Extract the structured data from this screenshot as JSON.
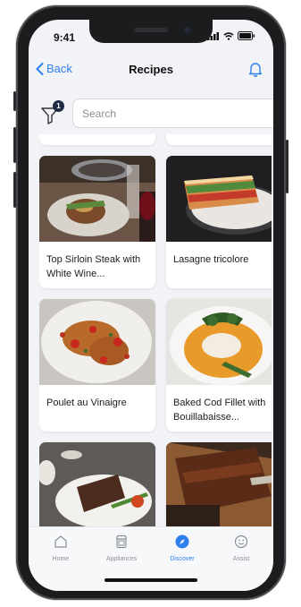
{
  "status": {
    "time": "9:41"
  },
  "nav": {
    "back_label": "Back",
    "title": "Recipes"
  },
  "filter": {
    "badge_count": "1"
  },
  "search": {
    "placeholder": "Search"
  },
  "recipes": [
    {
      "label": "Top Sirloin Steak with White Wine..."
    },
    {
      "label": "Lasagne tricolore"
    },
    {
      "label": "Poulet au Vinaigre"
    },
    {
      "label": "Baked Cod Fillet with Bouillabaisse..."
    },
    {
      "label": ""
    },
    {
      "label": ""
    }
  ],
  "tabbar": {
    "items": [
      {
        "label": "Home",
        "icon": "home-icon"
      },
      {
        "label": "Appliances",
        "icon": "appliance-icon"
      },
      {
        "label": "Discover",
        "icon": "compass-icon"
      },
      {
        "label": "Assist",
        "icon": "smiley-icon"
      }
    ],
    "active_index": 2
  },
  "colors": {
    "accent": "#2f80ed",
    "badge": "#1e2a44",
    "background": "#f2f3f6"
  }
}
